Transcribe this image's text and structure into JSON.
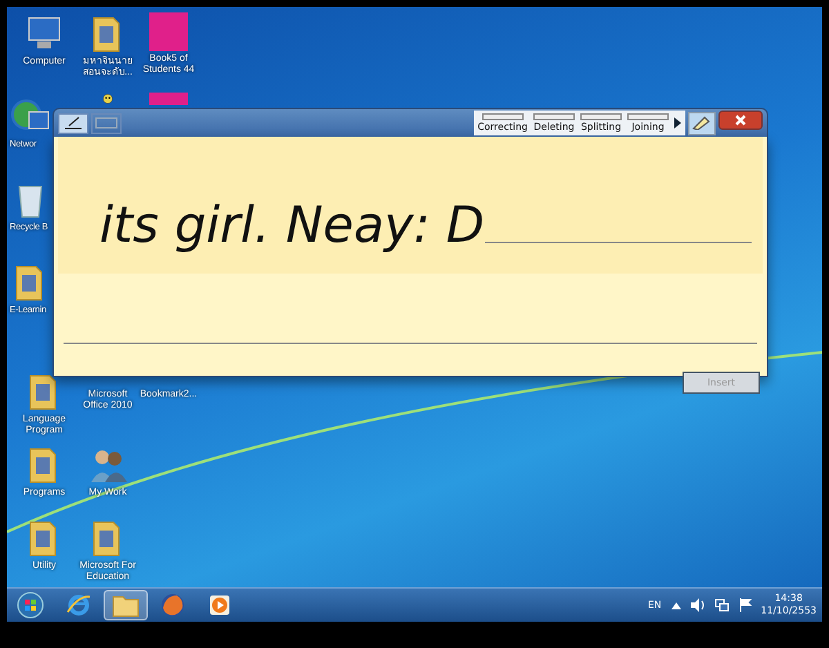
{
  "desktop": {
    "icons": [
      {
        "label": "Computer",
        "kind": "computer"
      },
      {
        "label": "มหาจินนาย สอนจะดับ...",
        "kind": "folder"
      },
      {
        "label": "Book5 of Students 44",
        "kind": "photo"
      },
      {
        "label": "Networ",
        "kind": "network"
      },
      {
        "kind": "smiley"
      },
      {
        "kind": "photo"
      },
      {
        "label": "Recycle B",
        "kind": "trash"
      },
      {
        "label": "E-Learnin",
        "kind": "folder"
      },
      {
        "label": "Language Program",
        "kind": "folder"
      },
      {
        "label": "Microsoft Office 2010",
        "kind": "hidden"
      },
      {
        "label": "Bookmark2...",
        "kind": "hidden"
      },
      {
        "label": "Programs",
        "kind": "folder"
      },
      {
        "label": "My Work",
        "kind": "people"
      },
      {
        "label": "Utility",
        "kind": "folder"
      },
      {
        "label": "Microsoft For Education",
        "kind": "folder"
      }
    ]
  },
  "input_panel": {
    "gestures": [
      "Correcting",
      "Deleting",
      "Splitting",
      "Joining"
    ],
    "handwriting": "its girl. Neay: D",
    "insert_button": {
      "label": "Insert",
      "disabled": true
    }
  },
  "taskbar": {
    "apps": [
      {
        "kind": "ie",
        "selected": false
      },
      {
        "kind": "explorer",
        "selected": true
      },
      {
        "kind": "firefox",
        "selected": false
      },
      {
        "kind": "media",
        "selected": false
      }
    ],
    "language": "EN",
    "time": "14:38",
    "date": "11/10/2553"
  }
}
